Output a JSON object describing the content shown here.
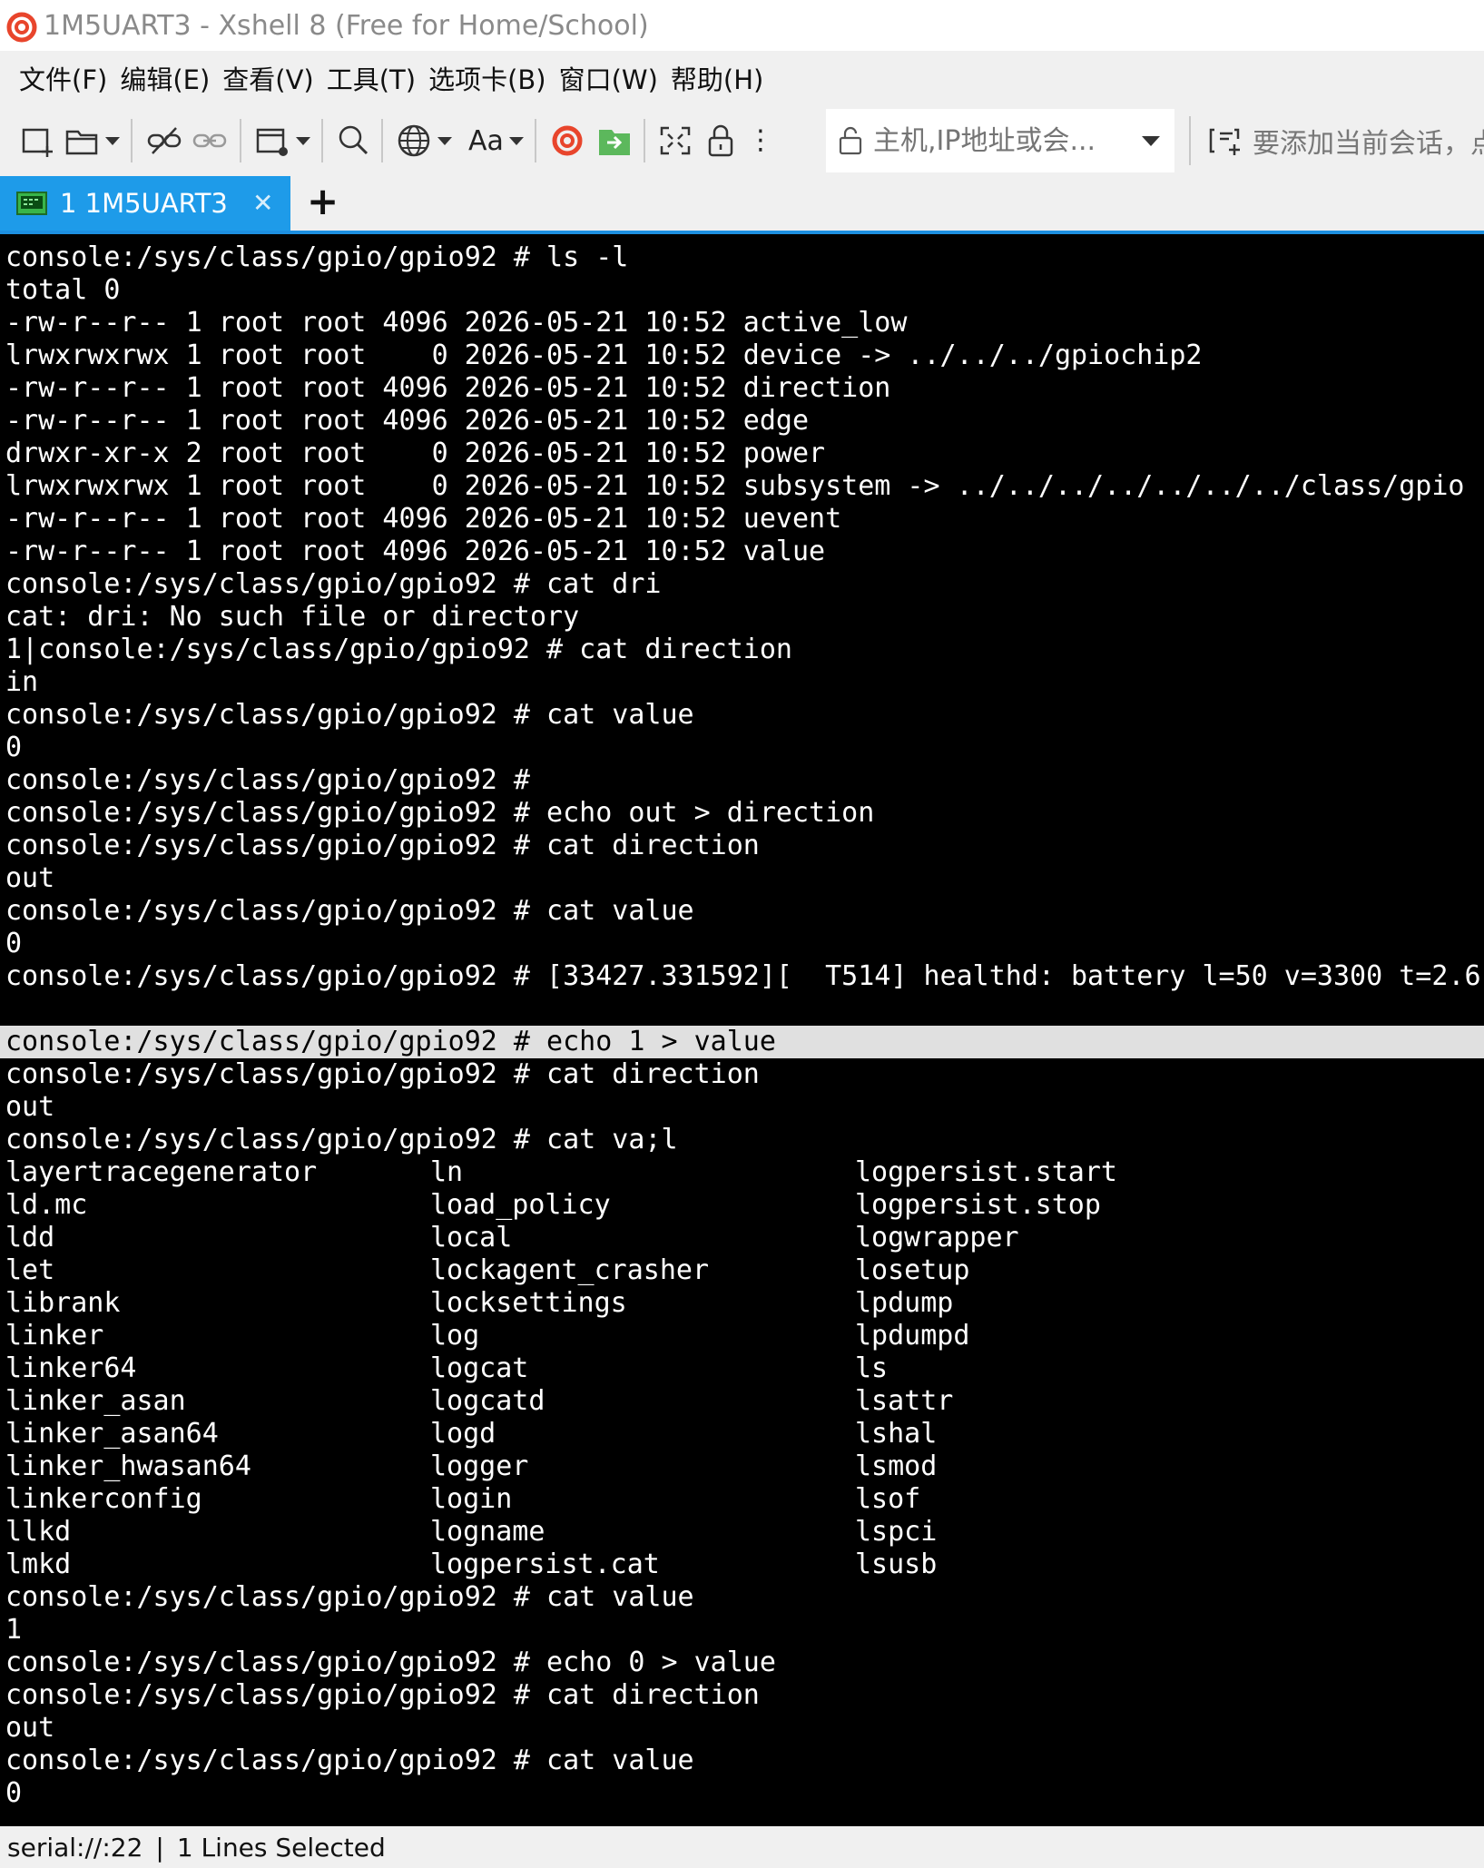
{
  "window": {
    "title": "1M5UART3 - Xshell 8 (Free for Home/School)"
  },
  "menu": [
    "文件(F)",
    "编辑(E)",
    "查看(V)",
    "工具(T)",
    "选项卡(B)",
    "窗口(W)",
    "帮助(H)"
  ],
  "toolbar": {
    "font_label": "Aa",
    "address_placeholder": "主机,IP地址或会...",
    "add_session_text": "要添加当前会话，点"
  },
  "tab": {
    "label": "1 1M5UART3",
    "close_glyph": "✕",
    "add_glyph": "+"
  },
  "terminal": {
    "lines": [
      "console:/sys/class/gpio/gpio92 # ls -l",
      "total 0",
      "-rw-r--r-- 1 root root 4096 2026-05-21 10:52 active_low",
      "lrwxrwxrwx 1 root root    0 2026-05-21 10:52 device -> ../../../gpiochip2",
      "-rw-r--r-- 1 root root 4096 2026-05-21 10:52 direction",
      "-rw-r--r-- 1 root root 4096 2026-05-21 10:52 edge",
      "drwxr-xr-x 2 root root    0 2026-05-21 10:52 power",
      "lrwxrwxrwx 1 root root    0 2026-05-21 10:52 subsystem -> ../../../../../../../class/gpio",
      "-rw-r--r-- 1 root root 4096 2026-05-21 10:52 uevent",
      "-rw-r--r-- 1 root root 4096 2026-05-21 10:52 value",
      "console:/sys/class/gpio/gpio92 # cat dri",
      "cat: dri: No such file or directory",
      "1|console:/sys/class/gpio/gpio92 # cat direction",
      "in",
      "console:/sys/class/gpio/gpio92 # cat value",
      "0",
      "console:/sys/class/gpio/gpio92 #",
      "console:/sys/class/gpio/gpio92 # echo out > direction",
      "console:/sys/class/gpio/gpio92 # cat direction",
      "out",
      "console:/sys/class/gpio/gpio92 # cat value",
      "0",
      "console:/sys/class/gpio/gpio92 # [33427.331592][  T514] healthd: battery l=50 v=3300 t=2.6",
      ""
    ],
    "selected_line": "console:/sys/class/gpio/gpio92 # echo 1 > value",
    "lines_after_selection": [
      "console:/sys/class/gpio/gpio92 # cat direction",
      "out",
      "console:/sys/class/gpio/gpio92 # cat va;l"
    ],
    "completions": [
      [
        "layertracegenerator",
        "ln",
        "logpersist.start"
      ],
      [
        "ld.mc",
        "load_policy",
        "logpersist.stop"
      ],
      [
        "ldd",
        "local",
        "logwrapper"
      ],
      [
        "let",
        "lockagent_crasher",
        "losetup"
      ],
      [
        "librank",
        "locksettings",
        "lpdump"
      ],
      [
        "linker",
        "log",
        "lpdumpd"
      ],
      [
        "linker64",
        "logcat",
        "ls"
      ],
      [
        "linker_asan",
        "logcatd",
        "lsattr"
      ],
      [
        "linker_asan64",
        "logd",
        "lshal"
      ],
      [
        "linker_hwasan64",
        "logger",
        "lsmod"
      ],
      [
        "linkerconfig",
        "login",
        "lsof"
      ],
      [
        "llkd",
        "logname",
        "lspci"
      ],
      [
        "lmkd",
        "logpersist.cat",
        "lsusb"
      ]
    ],
    "tail_lines": [
      "console:/sys/class/gpio/gpio92 # cat value",
      "1",
      "console:/sys/class/gpio/gpio92 # echo 0 > value",
      "console:/sys/class/gpio/gpio92 # cat direction",
      "out",
      "console:/sys/class/gpio/gpio92 # cat value",
      "0"
    ]
  },
  "status": {
    "connection": "serial://:22",
    "separator": "|",
    "selection": "1 Lines Selected"
  },
  "colors": {
    "tab_active": "#1e9be9",
    "terminal_bg": "#000000",
    "terminal_fg": "#ffffff",
    "selection_bg": "#e0e0e0"
  },
  "icons": [
    "new-session-icon",
    "open-folder-icon",
    "disconnect-icon",
    "reconnect-icon",
    "new-window-icon",
    "search-icon",
    "globe-icon",
    "font-icon",
    "xshell-logo-icon",
    "xftp-icon",
    "fullscreen-icon",
    "lock-icon",
    "more-icon",
    "address-lock-icon",
    "add-session-icon"
  ]
}
